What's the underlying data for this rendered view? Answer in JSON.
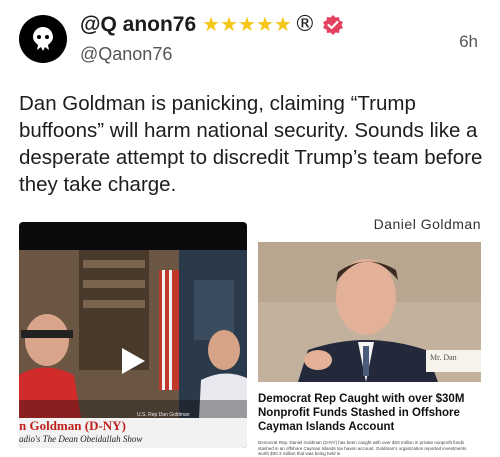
{
  "post": {
    "display_name": "@Q anon76",
    "handle": "@Qanon76",
    "time": "6h",
    "rating_stars": 5,
    "registered_mark": "®",
    "body": "Dan Goldman is panicking, claiming “Trump buffoons” will harm national security. Sounds like a desperate attempt to discredit Trump’s team before they take charge."
  },
  "media_left": {
    "caption_title": "n Goldman (D-NY)",
    "caption_sub": "adio's The Dean Obeidallah Show",
    "lower_third": "U.S. Rep Dan Goldman"
  },
  "media_right": {
    "top_label": "Daniel Goldman",
    "nameplate": "Mr. Dan",
    "headline": "Democrat Rep Caught with over $30M Nonprofit Funds Stashed in Offshore Cayman Islands Account",
    "fine_print": "Democrat Rep. Daniel Goldman (D-NY) has been caught with over $30 million in private nonprofit funds stashed in an offshore Cayman Islands tax haven account. Goldman's organization reported investments worth $30.3 million that was being held in"
  },
  "colors": {
    "star": "#f5c518",
    "verified": "#e4405f",
    "caption_red": "#c0201e"
  }
}
